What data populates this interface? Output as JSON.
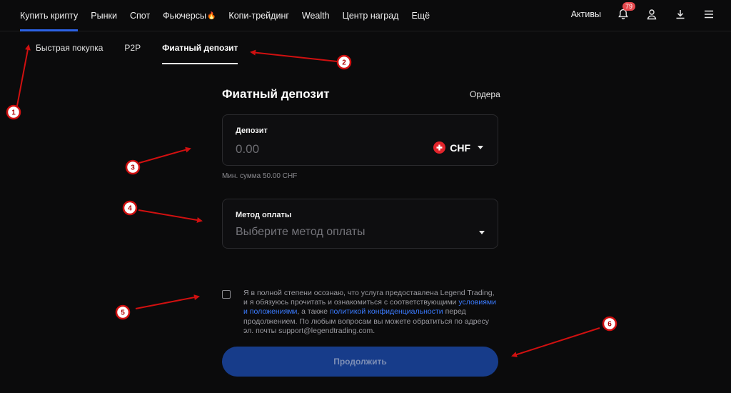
{
  "nav": {
    "items": [
      "Купить крипту",
      "Рынки",
      "Спот",
      "Фьючерсы",
      "Копи-трейдинг",
      "Wealth",
      "Центр наград",
      "Ещё"
    ],
    "active_index": 0,
    "right": {
      "assets_label": "Активы",
      "notifications_count": "79"
    }
  },
  "subtabs": {
    "items": [
      "Быстрая покупка",
      "P2P",
      "Фиатный депозит"
    ],
    "active_index": 2
  },
  "form": {
    "title": "Фиатный депозит",
    "orders_link": "Ордера",
    "deposit": {
      "label": "Депозит",
      "placeholder": "0.00",
      "currency": "CHF"
    },
    "min_note": "Мин. сумма 50.00 CHF",
    "method": {
      "label": "Метод оплаты",
      "placeholder": "Выберите метод оплаты"
    },
    "consent": {
      "part1": "Я в полной степени осознаю, что услуга предоставлена Legend Trading, и я обязуюсь прочитать и ознакомиться с соответствующими",
      "link1": "условиями и положениями",
      "part2": ", а также",
      "link2": "политикой конфиденциальности",
      "part3": "перед продолжением. По любым вопросам вы можете обратиться по адресу эл. почты support@legendtrading.com."
    },
    "continue_label": "Продолжить"
  },
  "annotations": [
    "1",
    "2",
    "3",
    "4",
    "5",
    "6"
  ],
  "colors": {
    "accent": "#2d63e6",
    "button": "#173c8a",
    "link": "#3a7bff",
    "annotation": "#d01010"
  }
}
